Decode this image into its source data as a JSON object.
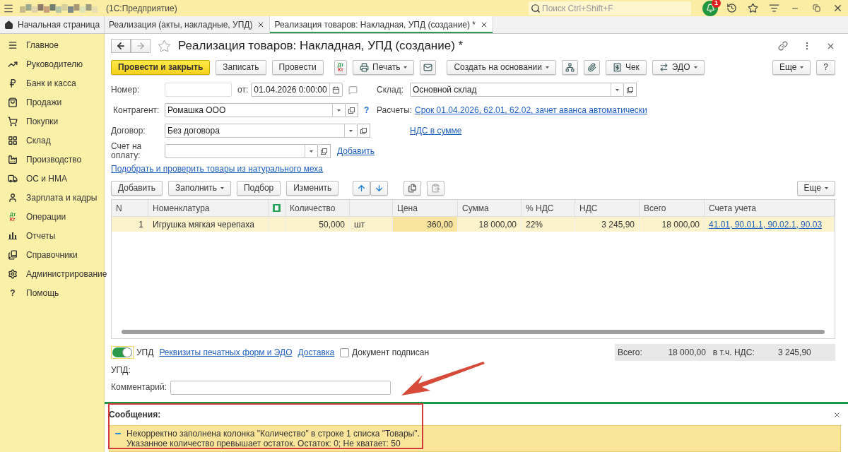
{
  "app_bar": {
    "title": "(1С:Предприятие)",
    "search": {
      "placeholder": "Поиск Ctrl+Shift+F"
    },
    "notifications": "1"
  },
  "tabs": [
    {
      "label": "Начальная страница",
      "selected": false,
      "kind": "home"
    },
    {
      "label": "Реализация (акты, накладные, УПД)",
      "selected": false,
      "kind": "doc"
    },
    {
      "label": "Реализация товаров: Накладная, УПД (создание) *",
      "selected": true,
      "kind": "doc"
    }
  ],
  "sidebar": {
    "items": [
      {
        "label": "Главное"
      },
      {
        "label": "Руководителю"
      },
      {
        "label": "Банк и касса"
      },
      {
        "label": "Продажи"
      },
      {
        "label": "Покупки"
      },
      {
        "label": "Склад"
      },
      {
        "label": "Производство"
      },
      {
        "label": "ОС и НМА"
      },
      {
        "label": "Зарплата и кадры"
      },
      {
        "label": "Операции",
        "icon_text": [
          "Дт",
          "Кт"
        ]
      },
      {
        "label": "Отчеты"
      },
      {
        "label": "Справочники"
      },
      {
        "label": "Администрирование"
      },
      {
        "label": "Помощь",
        "icon_text": [
          "?"
        ]
      }
    ]
  },
  "form": {
    "title": "Реализация товаров: Накладная, УПД (создание) *",
    "toolbar": [
      {
        "kind": "primary",
        "label": "Провести и закрыть"
      },
      {
        "kind": "button",
        "label": "Записать"
      },
      {
        "kind": "button",
        "label": "Провести"
      },
      {
        "kind": "icon",
        "icon_text": [
          "Дт",
          "Кт"
        ]
      },
      {
        "kind": "menu",
        "label": "Печать"
      },
      {
        "kind": "icon"
      },
      {
        "kind": "menu",
        "label": "Создать на основании"
      },
      {
        "kind": "icon"
      },
      {
        "kind": "icon"
      },
      {
        "kind": "button",
        "label": "Чек"
      },
      {
        "kind": "menu",
        "label": "ЭДО"
      }
    ],
    "toolbar_right": [
      {
        "kind": "menu",
        "label": "Еще"
      },
      {
        "kind": "button",
        "label": "?"
      }
    ],
    "number": {
      "label": "Номер:"
    },
    "date": {
      "label": "от:",
      "value": "01.04.2026  0:00:00"
    },
    "warehouse": {
      "label": "Склад:",
      "value": "Основной склад"
    },
    "counterparty": {
      "label": "Контрагент:",
      "value": "Ромашка ООО",
      "help": "?"
    },
    "settlements": {
      "label": "Расчеты:",
      "link": "Срок 01.04.2026, 62.01, 62.02, зачет аванса автоматически"
    },
    "contract": {
      "label": "Договор:",
      "value": "Без договора"
    },
    "vat_link": "НДС в сумме",
    "invoice": {
      "label": "Счет на оплату:",
      "link": "Добавить"
    },
    "fur_link": "Подобрать и проверить товары из натурального меха",
    "table_toolbar": [
      {
        "kind": "button",
        "label": "Добавить",
        "disabled": false
      },
      {
        "kind": "menu",
        "label": "Заполнить",
        "disabled": false
      },
      {
        "kind": "button",
        "label": "Подбор",
        "disabled": false
      },
      {
        "kind": "button",
        "label": "Изменить",
        "disabled": false
      },
      {
        "kind": "up",
        "disabled": false
      },
      {
        "kind": "down",
        "disabled": false
      },
      {
        "kind": "copy",
        "disabled": false
      },
      {
        "kind": "paste",
        "disabled": true
      }
    ],
    "table_toolbar_right": {
      "label": "Еще"
    },
    "table": {
      "columns": [
        {
          "kind": "text",
          "label": "N"
        },
        {
          "kind": "text",
          "label": "Номенклатура"
        },
        {
          "kind": "icon"
        },
        {
          "kind": "text",
          "label": "Количество"
        },
        {
          "kind": "blank"
        },
        {
          "kind": "text",
          "label": "Цена"
        },
        {
          "kind": "text",
          "label": "Сумма"
        },
        {
          "kind": "text",
          "label": "% НДС"
        },
        {
          "kind": "text",
          "label": "НДС"
        },
        {
          "kind": "text",
          "label": "Всего"
        },
        {
          "kind": "text",
          "label": "Счета учета"
        }
      ],
      "rows": [
        {
          "selected": true,
          "cells": [
            {
              "text": "1",
              "focused": false
            },
            {
              "text": "Игрушка мягкая черепаха",
              "focused": false
            },
            {
              "focused": false
            },
            {
              "text": "50,000",
              "focused": false
            },
            {
              "text": "шт",
              "focused": false
            },
            {
              "text": "360,00",
              "focused": true
            },
            {
              "text": "18 000,00",
              "focused": false
            },
            {
              "text": "22%",
              "focused": false
            },
            {
              "text": "3 245,90",
              "focused": false
            },
            {
              "text": "18 000,00",
              "focused": false
            },
            {
              "text": "41.01, 90.01.1, 90.02.1, 90.03",
              "focused": false,
              "kind": "link"
            }
          ]
        }
      ]
    },
    "upd_switch": {
      "label": "УПД",
      "on": true
    },
    "links": [
      "Реквизиты печатных форм и ЭДО",
      "Доставка"
    ],
    "signed": {
      "label": "Документ подписан",
      "checked": false
    },
    "totals": {
      "total_label": "Всего:",
      "total": "18 000,00",
      "vat_label": "в т.ч. НДС:",
      "vat": "3 245,90"
    },
    "upd_label": "УПД:",
    "comment": {
      "label": "Комментарий:"
    }
  },
  "messages": {
    "title": "Сообщения:",
    "items": [
      {
        "lines": [
          "Некорректно заполнена колонка \"Количество\" в строке 1 списка \"Товары\".",
          "Указанное количество превышает остаток. Остаток: 0; Не хватает: 50"
        ]
      }
    ]
  }
}
